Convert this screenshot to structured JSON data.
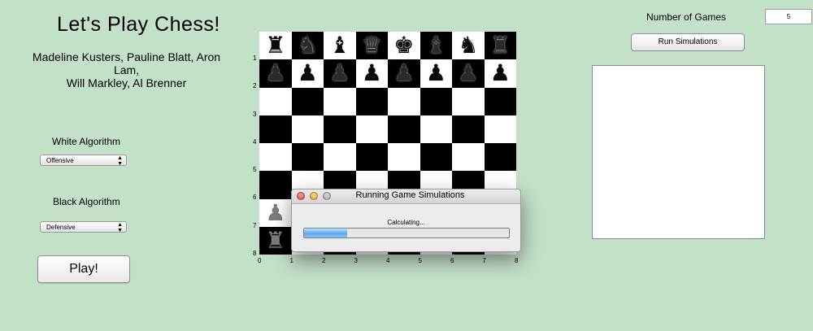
{
  "title": "Let's Play Chess!",
  "authors": [
    "Madeline Kusters, Pauline Blatt, Aron",
    "Lam,",
    "Will Markley, Al Brenner"
  ],
  "white_algorithm": {
    "label": "White Algorithm",
    "selected": "Offensive"
  },
  "black_algorithm": {
    "label": "Black Algorithm",
    "selected": "Defensive"
  },
  "play_label": "Play!",
  "board": {
    "rank_labels": [
      "1",
      "2",
      "3",
      "4",
      "5",
      "6",
      "7",
      "8"
    ],
    "file_labels": [
      "0",
      "1",
      "2",
      "3",
      "4",
      "5",
      "6",
      "7",
      "8"
    ],
    "pieces": [
      {
        "r": 0,
        "c": 0,
        "glyph": "♜",
        "color": "b"
      },
      {
        "r": 0,
        "c": 1,
        "glyph": "♞",
        "color": "b"
      },
      {
        "r": 0,
        "c": 2,
        "glyph": "♝",
        "color": "b"
      },
      {
        "r": 0,
        "c": 3,
        "glyph": "♛",
        "color": "b"
      },
      {
        "r": 0,
        "c": 4,
        "glyph": "♚",
        "color": "b"
      },
      {
        "r": 0,
        "c": 5,
        "glyph": "♝",
        "color": "b"
      },
      {
        "r": 0,
        "c": 6,
        "glyph": "♞",
        "color": "b"
      },
      {
        "r": 0,
        "c": 7,
        "glyph": "♜",
        "color": "b"
      },
      {
        "r": 1,
        "c": 0,
        "glyph": "♟",
        "color": "b"
      },
      {
        "r": 1,
        "c": 1,
        "glyph": "♟",
        "color": "b"
      },
      {
        "r": 1,
        "c": 2,
        "glyph": "♟",
        "color": "b"
      },
      {
        "r": 1,
        "c": 3,
        "glyph": "♟",
        "color": "b"
      },
      {
        "r": 1,
        "c": 4,
        "glyph": "♟",
        "color": "b"
      },
      {
        "r": 1,
        "c": 5,
        "glyph": "♟",
        "color": "b"
      },
      {
        "r": 1,
        "c": 6,
        "glyph": "♟",
        "color": "b"
      },
      {
        "r": 1,
        "c": 7,
        "glyph": "♟",
        "color": "b"
      },
      {
        "r": 6,
        "c": 0,
        "glyph": "♟",
        "color": "w"
      },
      {
        "r": 7,
        "c": 0,
        "glyph": "♜",
        "color": "w"
      }
    ]
  },
  "games": {
    "label": "Number of Games",
    "value": "5"
  },
  "run_label": "Run Simulations",
  "dialog": {
    "title": "Running Game Simulations",
    "status": "Calculating...",
    "progress": 0.21
  }
}
